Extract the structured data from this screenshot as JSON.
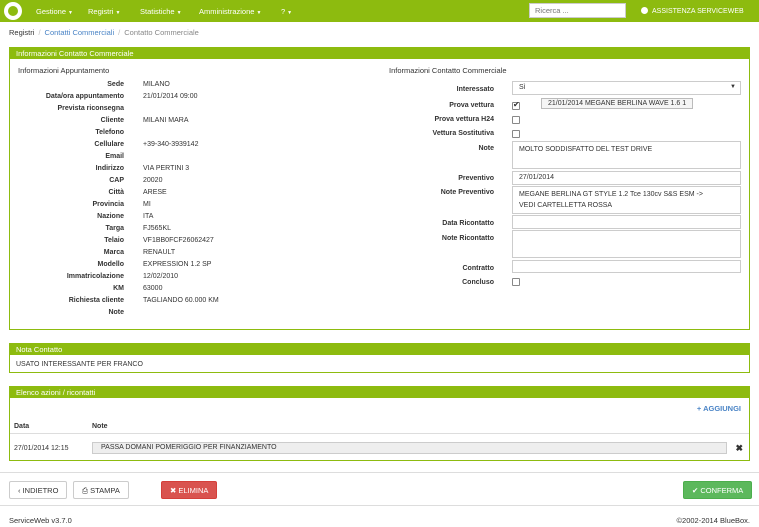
{
  "nav": {
    "items": [
      {
        "label": "Gestione"
      },
      {
        "label": "Registri"
      },
      {
        "label": "Statistiche"
      },
      {
        "label": "Amministrazione"
      },
      {
        "label": "?"
      }
    ],
    "search_placeholder": "Ricerca ...",
    "user": "ASSISTENZA SERVICEWEB"
  },
  "breadcrumb": {
    "root": "Registri",
    "link": "Contatti Commerciali",
    "current": "Contatto Commerciale"
  },
  "main_panel": {
    "title": "Informazioni Contatto Commerciale",
    "left_title": "Informazioni Appuntamento",
    "right_title": "Informazioni Contatto Commerciale",
    "appointment": [
      {
        "label": "Sede",
        "value": "MILANO"
      },
      {
        "label": "Data/ora appuntamento",
        "value": "21/01/2014 09:00"
      },
      {
        "label": "Prevista riconsegna",
        "value": ""
      },
      {
        "label": "Cliente",
        "value": "MILANI MARA"
      },
      {
        "label": "Telefono",
        "value": ""
      },
      {
        "label": "Cellulare",
        "value": "+39-340-3939142"
      },
      {
        "label": "Email",
        "value": ""
      },
      {
        "label": "Indirizzo",
        "value": "VIA PERTINI 3"
      },
      {
        "label": "CAP",
        "value": "20020"
      },
      {
        "label": "Città",
        "value": "ARESE"
      },
      {
        "label": "Provincia",
        "value": "MI"
      },
      {
        "label": "Nazione",
        "value": "ITA"
      },
      {
        "label": "Targa",
        "value": "FJ565KL"
      },
      {
        "label": "Telaio",
        "value": "VF1BB0FCF26062427"
      },
      {
        "label": "Marca",
        "value": "RENAULT"
      },
      {
        "label": "Modello",
        "value": "EXPRESSION 1.2 SP"
      },
      {
        "label": "Immatricolazione",
        "value": "12/02/2010"
      },
      {
        "label": "KM",
        "value": "63000"
      },
      {
        "label": "Richiesta cliente",
        "value": "TAGLIANDO 60.000 KM"
      },
      {
        "label": "Note",
        "value": ""
      }
    ],
    "contact": {
      "interessato_label": "Interessato",
      "interessato_value": "Sì",
      "prova_vettura_label": "Prova vettura",
      "prova_vettura_checked": true,
      "prova_vettura_tag": "21/01/2014 MEGANE BERLINA WAVE 1.6 1",
      "prova_h24_label": "Prova vettura H24",
      "vettura_sost_label": "Vettura Sostitutiva",
      "note_label": "Note",
      "note_value": "MOLTO SODDISFATTO DEL TEST DRIVE",
      "preventivo_label": "Preventivo",
      "preventivo_value": "27/01/2014",
      "note_prev_label": "Note Preventivo",
      "note_prev_line1": "MEGANE BERLINA GT STYLE 1.2 Tce 130cv S&S ESM ->",
      "note_prev_line2": "VEDI CARTELLETTA ROSSA",
      "data_ric_label": "Data Ricontatto",
      "note_ric_label": "Note Ricontatto",
      "contratto_label": "Contratto",
      "concluso_label": "Concluso"
    }
  },
  "nota_panel": {
    "title": "Nota Contatto",
    "text": "USATO INTERESSANTE PER FRANCO"
  },
  "elenco_panel": {
    "title": "Elenco azioni / ricontatti",
    "add_label": "+ AGGIUNGI",
    "col_date": "Data",
    "col_note": "Note",
    "rows": [
      {
        "date": "27/01/2014 12:15",
        "note": "PASSA DOMANI POMERIGGIO PER FINANZIAMENTO"
      }
    ]
  },
  "buttons": {
    "back": "INDIETRO",
    "print": "STAMPA",
    "delete": "ELIMINA",
    "confirm": "CONFERMA"
  },
  "footer": {
    "version": "ServiceWeb v3.7.0",
    "copyright": "©2002-2014 BlueBox."
  },
  "colors": {
    "brand": "#8dbb0f",
    "danger": "#d9534f",
    "success": "#5cb85c",
    "link": "#4a84c6"
  }
}
